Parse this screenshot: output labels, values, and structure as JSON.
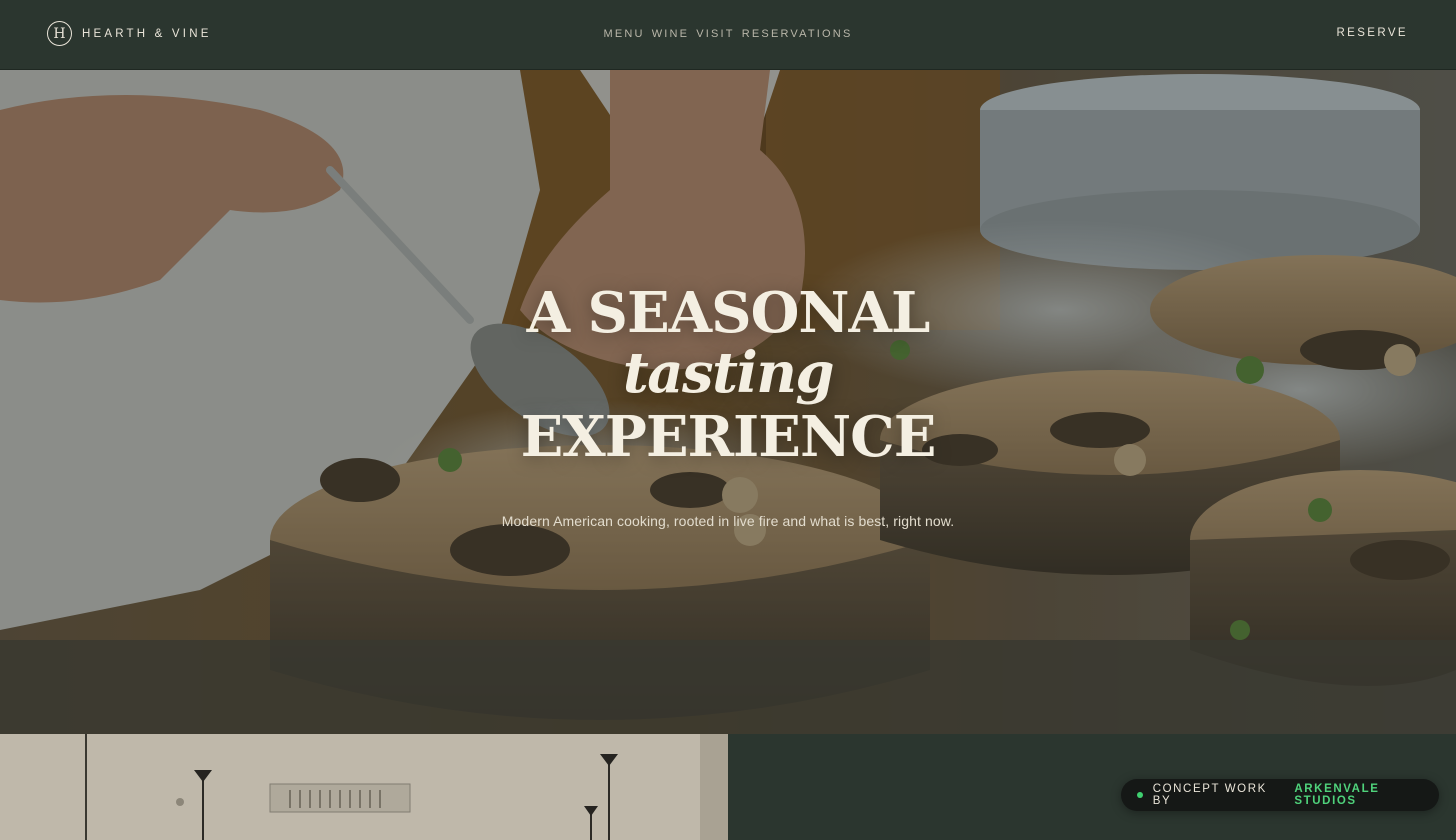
{
  "header": {
    "brand_initial": "H",
    "brand_name": "HEARTH & VINE",
    "nav": [
      {
        "label": "MENU"
      },
      {
        "label": "WINE"
      },
      {
        "label": "VISIT"
      },
      {
        "label": "RESERVATIONS"
      }
    ],
    "reserve_label": "RESERVE"
  },
  "hero": {
    "line1": "A SEASONAL",
    "line2": "tasting",
    "line3": "EXPERIENCE",
    "subtitle": "Modern American cooking, rooted in live fire and what is best, right now."
  },
  "credit": {
    "prefix": "CONCEPT WORK BY",
    "studio": "ARKENVALE STUDIOS"
  },
  "colors": {
    "background": "#2b362f",
    "text": "#e9e4d8",
    "accent_green": "#4fd27b"
  }
}
